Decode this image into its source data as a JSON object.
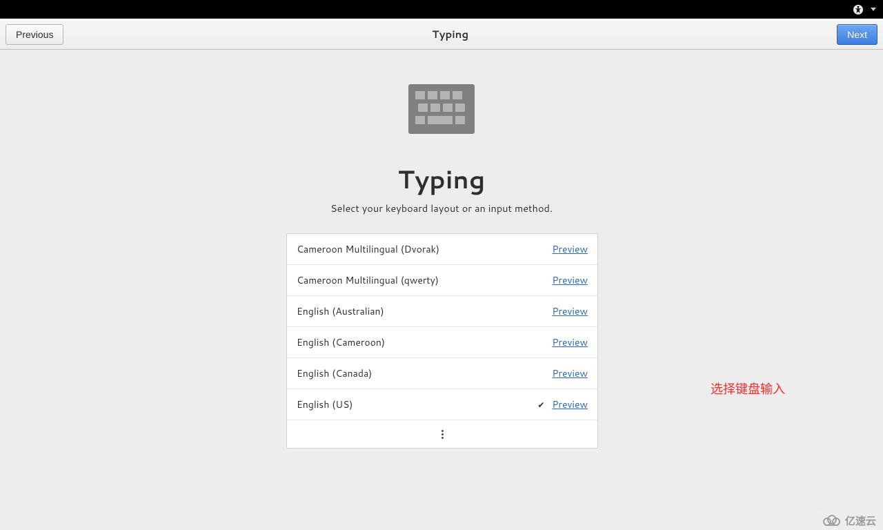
{
  "topbar": {
    "a11y_icon": "accessibility-icon",
    "chevron_icon": "chevron-down-icon"
  },
  "header": {
    "previous_label": "Previous",
    "title": "Typing",
    "next_label": "Next"
  },
  "page": {
    "heading": "Typing",
    "subtitle": "Select your keyboard layout or an input method."
  },
  "layouts": {
    "preview_label": "Preview",
    "items": [
      {
        "label": "Cameroon Multilingual (Dvorak)",
        "selected": false
      },
      {
        "label": "Cameroon Multilingual (qwerty)",
        "selected": false
      },
      {
        "label": "English (Australian)",
        "selected": false
      },
      {
        "label": "English (Cameroon)",
        "selected": false
      },
      {
        "label": "English (Canada)",
        "selected": false
      },
      {
        "label": "English (US)",
        "selected": true
      }
    ]
  },
  "annotation": "选择键盘输入",
  "watermark": "亿速云"
}
